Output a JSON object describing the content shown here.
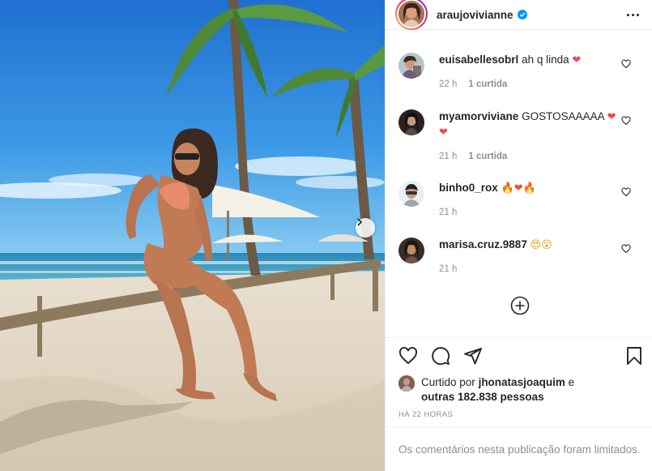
{
  "post": {
    "username": "araujovivianne",
    "verified": true
  },
  "comments": [
    {
      "user": "euisabellesobrl",
      "text": "ah q linda",
      "emoji": "❤",
      "age": "22 h",
      "likes": "1 curtida"
    },
    {
      "user": "myamorviviane",
      "text": "GOSTOSAAAAA",
      "emoji": "❤❤",
      "age": "21 h",
      "likes": "1 curtida"
    },
    {
      "user": "binho0_rox",
      "text": "",
      "emoji": "🔥❤🔥",
      "age": "21 h",
      "likes": ""
    },
    {
      "user": "marisa.cruz.9887",
      "text": "",
      "emoji": "😍😮",
      "age": "21 h",
      "likes": ""
    }
  ],
  "liked_by": {
    "prefix": "Curtido por",
    "user": "jhonatasjoaquim",
    "connector": "e",
    "others": "outras 182.838 pessoas"
  },
  "timestamp": "HÁ 22 HORAS",
  "comments_limited": "Os comentários nesta publicação foram limitados.",
  "colors": {
    "heart_red": "#ed4956",
    "verified_blue": "#0095f6",
    "muted_text": "#8e8e8e",
    "border": "#efefef"
  },
  "icons": [
    "more-options-icon",
    "heart-icon",
    "comment-icon",
    "share-icon",
    "bookmark-icon",
    "plus-circle-icon",
    "chevron-right-icon",
    "verified-badge-icon"
  ]
}
